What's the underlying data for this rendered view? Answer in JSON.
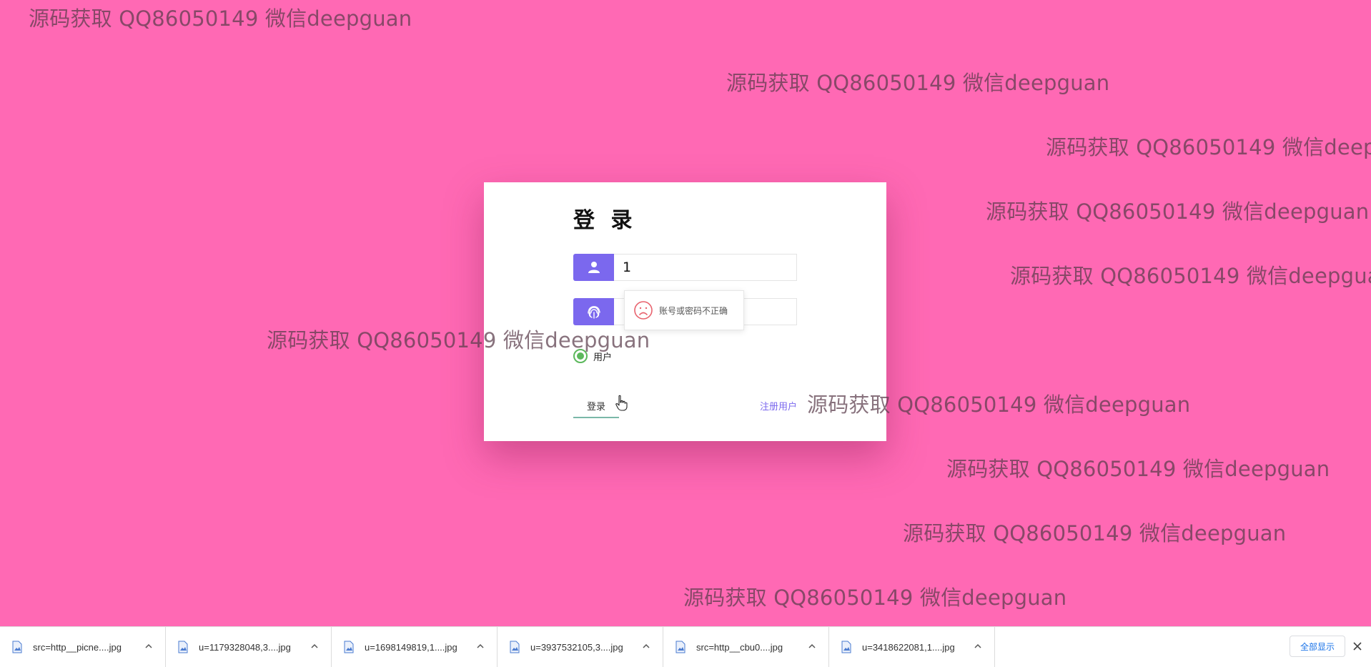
{
  "watermark_text": "源码获取 QQ86050149 微信deepguan",
  "login": {
    "title": "登 录",
    "username_value": "1",
    "password_value": "•",
    "toast_message": "账号或密码不正确",
    "role_label": "用户",
    "submit_label": "登录",
    "register_label": "注册用户"
  },
  "downloads": {
    "items": [
      {
        "name": "src=http__picne....jpg"
      },
      {
        "name": "u=1179328048,3....jpg"
      },
      {
        "name": "u=1698149819,1....jpg"
      },
      {
        "name": "u=3937532105,3....jpg"
      },
      {
        "name": "src=http__cbu0....jpg"
      },
      {
        "name": "u=3418622081,1....jpg"
      }
    ],
    "show_all_label": "全部显示"
  },
  "colors": {
    "background": "#ff69b4",
    "accent": "#7b68ee",
    "radio_checked": "#5cb85c",
    "link": "#7b68ee",
    "download_bar_link": "#1a73e8"
  },
  "icons": {
    "username": "user-icon",
    "password": "fingerprint-icon",
    "toast": "sad-face-icon",
    "download_file": "image-file-icon",
    "download_menu": "chevron-up-icon",
    "bar_close": "close-icon",
    "pointer": "hand-cursor-icon"
  }
}
